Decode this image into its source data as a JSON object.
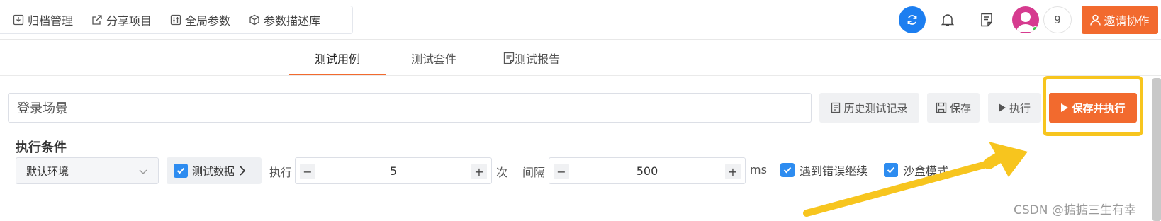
{
  "toolbar": {
    "items": [
      {
        "label": "归档管理",
        "icon": "archive-icon"
      },
      {
        "label": "分享项目",
        "icon": "share-icon"
      },
      {
        "label": "全局参数",
        "icon": "params-icon"
      },
      {
        "label": "参数描述库",
        "icon": "cube-icon"
      }
    ]
  },
  "header": {
    "notification_count": "9",
    "invite_label": "邀请协作",
    "sync_color": "#1c7ef0",
    "accent_color": "#f26a2e"
  },
  "tabs": [
    {
      "label": "测试用例",
      "active": true
    },
    {
      "label": "测试套件",
      "active": false
    },
    {
      "label": "测试报告",
      "active": false,
      "icon": "report-icon"
    }
  ],
  "case": {
    "name_value": "登录场景",
    "history_label": "历史测试记录",
    "save_label": "保存",
    "run_label": "执行",
    "save_run_label": "保存并执行"
  },
  "conditions": {
    "title": "执行条件",
    "environment": "默认环境",
    "test_data_label": "测试数据",
    "exec_label": "执行",
    "times_value": "5",
    "times_unit": "次",
    "interval_label": "间隔",
    "interval_value": "500",
    "interval_unit": "ms",
    "continue_on_error_label": "遇到错误继续",
    "continue_on_error_checked": true,
    "sandbox_label": "沙盒模式",
    "sandbox_checked": true,
    "test_data_checked": true
  },
  "annotation": {
    "highlight_color": "#f7c51e"
  },
  "watermark": "CSDN @掂掂三生有幸"
}
